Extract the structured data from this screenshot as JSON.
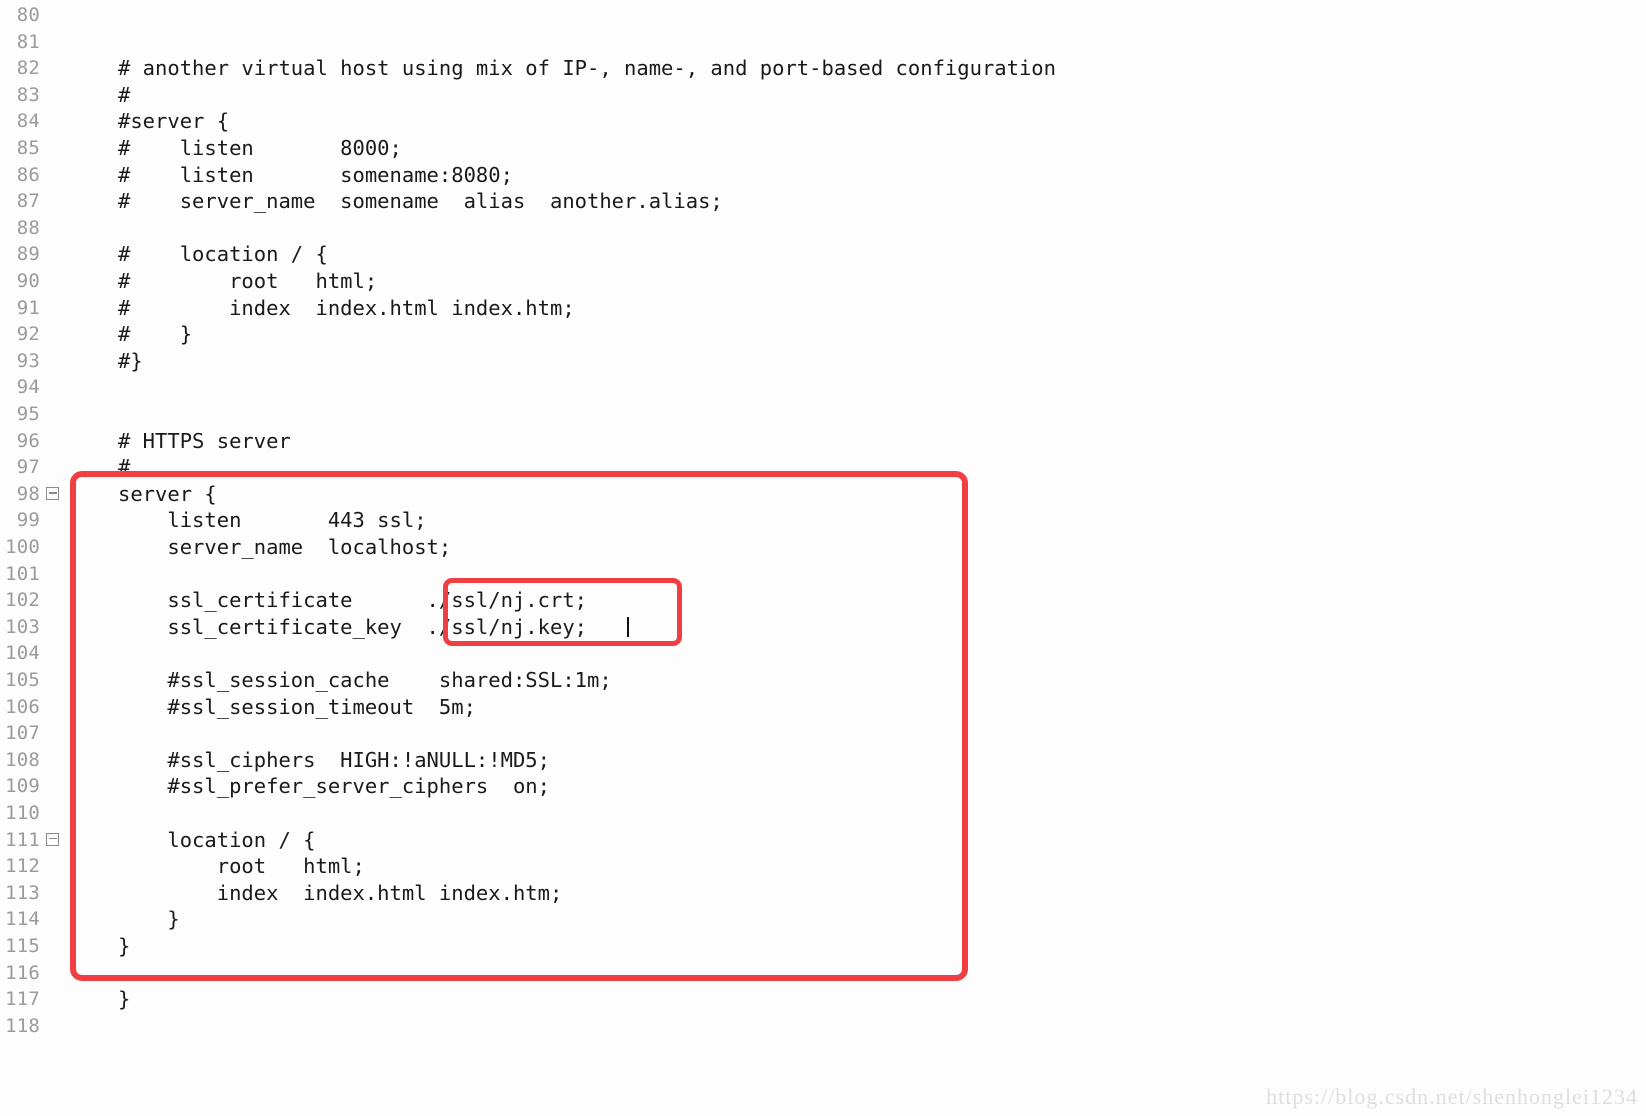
{
  "editor": {
    "language": "nginx",
    "background_color": "#fdfdfd",
    "text_color": "#1a1a1a",
    "gutter_color": "#9b9b9b",
    "annotation_color": "#ef3f42",
    "first_line_number": 80,
    "last_line_number": 118,
    "lines": [
      {
        "num": "80",
        "text": "",
        "fold": false
      },
      {
        "num": "81",
        "text": "",
        "fold": false
      },
      {
        "num": "82",
        "text": "# another virtual host using mix of IP-, name-, and port-based configuration",
        "fold": false
      },
      {
        "num": "83",
        "text": "#",
        "fold": false
      },
      {
        "num": "84",
        "text": "#server {",
        "fold": false
      },
      {
        "num": "85",
        "text": "#    listen       8000;",
        "fold": false
      },
      {
        "num": "86",
        "text": "#    listen       somename:8080;",
        "fold": false
      },
      {
        "num": "87",
        "text": "#    server_name  somename  alias  another.alias;",
        "fold": false
      },
      {
        "num": "88",
        "text": "",
        "fold": false
      },
      {
        "num": "89",
        "text": "#    location / {",
        "fold": false
      },
      {
        "num": "90",
        "text": "#        root   html;",
        "fold": false
      },
      {
        "num": "91",
        "text": "#        index  index.html index.htm;",
        "fold": false
      },
      {
        "num": "92",
        "text": "#    }",
        "fold": false
      },
      {
        "num": "93",
        "text": "#}",
        "fold": false
      },
      {
        "num": "94",
        "text": "",
        "fold": false
      },
      {
        "num": "95",
        "text": "",
        "fold": false
      },
      {
        "num": "96",
        "text": "# HTTPS server",
        "fold": false
      },
      {
        "num": "97",
        "text": "#",
        "fold": false
      },
      {
        "num": "98",
        "text": "server {",
        "fold": true
      },
      {
        "num": "99",
        "text": "    listen       443 ssl;",
        "fold": false
      },
      {
        "num": "100",
        "text": "    server_name  localhost;",
        "fold": false
      },
      {
        "num": "101",
        "text": "",
        "fold": false
      },
      {
        "num": "102",
        "text": "    ssl_certificate      ./ssl/nj.crt;",
        "fold": false
      },
      {
        "num": "103",
        "text": "    ssl_certificate_key  ./ssl/nj.key;",
        "fold": false
      },
      {
        "num": "104",
        "text": "",
        "fold": false
      },
      {
        "num": "105",
        "text": "    #ssl_session_cache    shared:SSL:1m;",
        "fold": false
      },
      {
        "num": "106",
        "text": "    #ssl_session_timeout  5m;",
        "fold": false
      },
      {
        "num": "107",
        "text": "",
        "fold": false
      },
      {
        "num": "108",
        "text": "    #ssl_ciphers  HIGH:!aNULL:!MD5;",
        "fold": false
      },
      {
        "num": "109",
        "text": "    #ssl_prefer_server_ciphers  on;",
        "fold": false
      },
      {
        "num": "110",
        "text": "",
        "fold": false
      },
      {
        "num": "111",
        "text": "    location / {",
        "fold": true
      },
      {
        "num": "112",
        "text": "        root   html;",
        "fold": false
      },
      {
        "num": "113",
        "text": "        index  index.html index.htm;",
        "fold": false
      },
      {
        "num": "114",
        "text": "    }",
        "fold": false
      },
      {
        "num": "115",
        "text": "}",
        "fold": false
      },
      {
        "num": "116",
        "text": "",
        "fold": false
      },
      {
        "num": "117",
        "text": "}",
        "fold": false
      },
      {
        "num": "118",
        "text": "",
        "fold": false
      }
    ]
  },
  "annotations": {
    "server_block_highlight": {
      "label": "https-server-block",
      "color": "#ef3f42",
      "covers_lines": "98-116"
    },
    "ssl_paths_highlight": {
      "label": "ssl-certificate-paths",
      "color": "#ef3f42",
      "covers_lines": "102-103",
      "values": [
        "./ssl/nj.crt;",
        "./ssl/nj.key;"
      ]
    }
  },
  "caret": {
    "line": "103",
    "after_text": "./ssl/nj.key;"
  },
  "watermark": {
    "text": "https://blog.csdn.net/shenhonglei1234"
  }
}
